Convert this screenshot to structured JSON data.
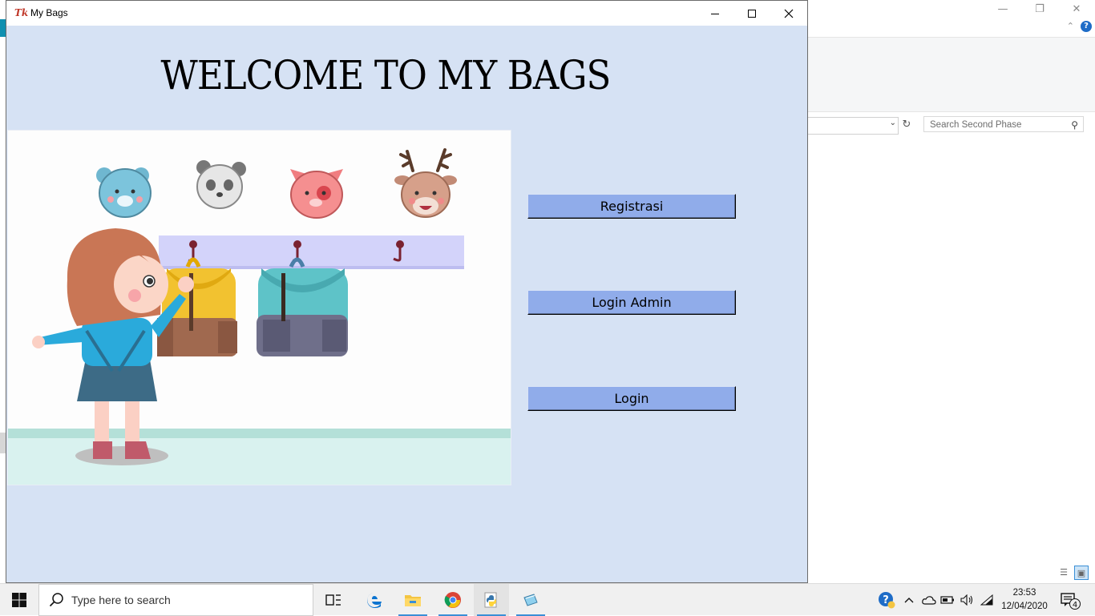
{
  "window": {
    "title": "My Bags",
    "logo_text": "Tk",
    "heading": "WELCOME TO MY BAGS",
    "illustration": "girl-hanging-backpacks-illustration"
  },
  "buttons": {
    "registrasi": "Registrasi",
    "login_admin": "Login Admin",
    "login": "Login"
  },
  "background_window": {
    "search_placeholder": "Search Second Phase"
  },
  "taskbar": {
    "search_placeholder": "Type here to search",
    "time": "23:53",
    "date": "12/04/2020",
    "notification_count": "4",
    "apps": [
      "task-view-icon",
      "edge-icon",
      "file-explorer-icon",
      "chrome-icon",
      "python-icon",
      "notepad-icon"
    ]
  },
  "colors": {
    "window_bg": "#d6e2f4",
    "button_bg": "#90acea"
  }
}
